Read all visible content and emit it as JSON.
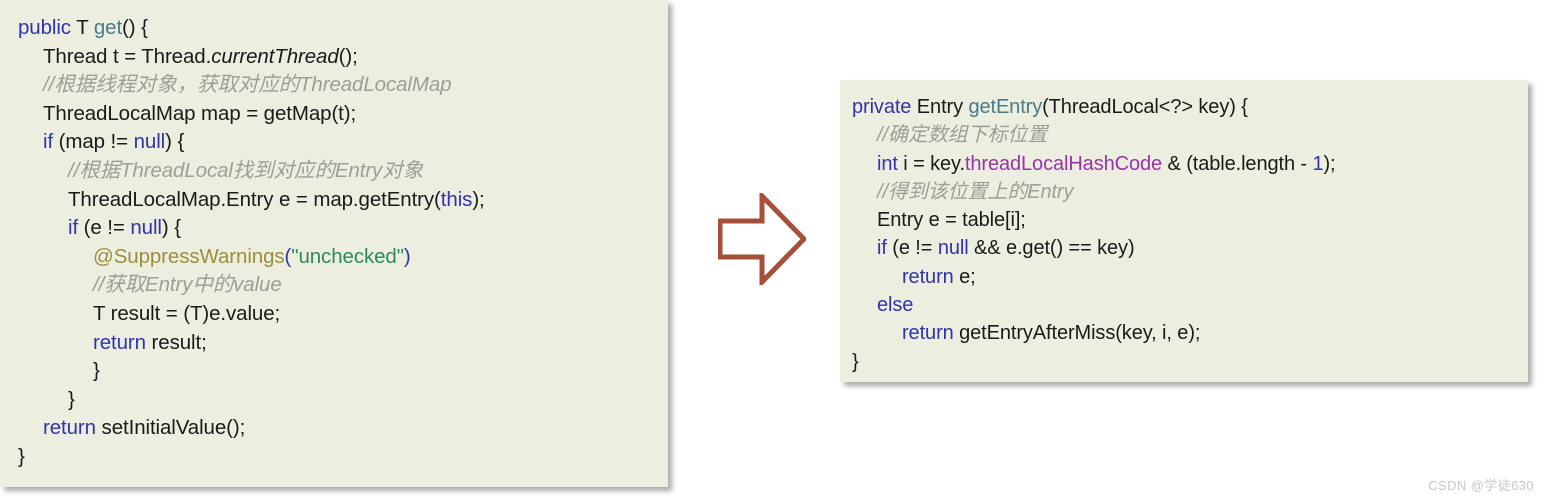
{
  "colors": {
    "panel_background": "#ECEEDF",
    "page_background": "#FFFFFF",
    "keyword": "#3333AA",
    "method": "#4A7A8C",
    "field": "#9933AA",
    "annotation": "#9A8F3C",
    "string": "#2E8B57",
    "comment": "#9E9E96",
    "arrow": "#A6503A"
  },
  "left_panel": {
    "name": "ThreadLocal.get source snippet",
    "lines": [
      {
        "indent": 0,
        "tokens": [
          {
            "text": "public",
            "cls": "t-kw"
          },
          {
            "text": " T ",
            "cls": "t-plain"
          },
          {
            "text": "get",
            "cls": "t-method"
          },
          {
            "text": "() {",
            "cls": "t-plain"
          }
        ]
      },
      {
        "indent": 1,
        "tokens": [
          {
            "text": "Thread t = Thread.",
            "cls": "t-plain"
          },
          {
            "text": "currentThread",
            "cls": "t-plain t-italic"
          },
          {
            "text": "();",
            "cls": "t-plain"
          }
        ]
      },
      {
        "indent": 1,
        "tokens": [
          {
            "text": "//根据线程对象，获取对应的ThreadLocalMap",
            "cls": "t-comment"
          }
        ]
      },
      {
        "indent": 1,
        "tokens": [
          {
            "text": "ThreadLocalMap map = getMap(t);",
            "cls": "t-plain"
          }
        ]
      },
      {
        "indent": 1,
        "tokens": [
          {
            "text": "if",
            "cls": "t-kw"
          },
          {
            "text": " (map != ",
            "cls": "t-plain"
          },
          {
            "text": "null",
            "cls": "t-kw"
          },
          {
            "text": ") {",
            "cls": "t-plain"
          }
        ]
      },
      {
        "indent": 2,
        "tokens": [
          {
            "text": "//根据ThreadLocal找到对应的Entry对象",
            "cls": "t-comment"
          }
        ]
      },
      {
        "indent": 2,
        "tokens": [
          {
            "text": "ThreadLocalMap.Entry e = map.getEntry(",
            "cls": "t-plain"
          },
          {
            "text": "this",
            "cls": "t-kw"
          },
          {
            "text": ");",
            "cls": "t-plain"
          }
        ]
      },
      {
        "indent": 2,
        "tokens": [
          {
            "text": "if",
            "cls": "t-kw"
          },
          {
            "text": " (e != ",
            "cls": "t-plain"
          },
          {
            "text": "null",
            "cls": "t-kw"
          },
          {
            "text": ") {",
            "cls": "t-plain"
          }
        ]
      },
      {
        "indent": 3,
        "tokens": [
          {
            "text": "@SuppressWarnings",
            "cls": "t-anno"
          },
          {
            "text": "(",
            "cls": "t-kw"
          },
          {
            "text": "\"unchecked\"",
            "cls": "t-str"
          },
          {
            "text": ")",
            "cls": "t-kw"
          }
        ]
      },
      {
        "indent": 3,
        "tokens": [
          {
            "text": "//获取Entry中的value",
            "cls": "t-comment"
          }
        ]
      },
      {
        "indent": 3,
        "tokens": [
          {
            "text": "T result = (T)e.value;",
            "cls": "t-plain"
          }
        ]
      },
      {
        "indent": 3,
        "tokens": [
          {
            "text": "return",
            "cls": "t-kw"
          },
          {
            "text": " result;",
            "cls": "t-plain"
          }
        ]
      },
      {
        "indent": 3,
        "tokens": [
          {
            "text": "}",
            "cls": "t-plain"
          }
        ]
      },
      {
        "indent": 2,
        "tokens": [
          {
            "text": "}",
            "cls": "t-plain"
          }
        ]
      },
      {
        "indent": 1,
        "tokens": [
          {
            "text": "return",
            "cls": "t-kw"
          },
          {
            "text": " setInitialValue();",
            "cls": "t-plain"
          }
        ]
      },
      {
        "indent": 0,
        "tokens": [
          {
            "text": "}",
            "cls": "t-plain"
          }
        ]
      }
    ]
  },
  "right_panel": {
    "name": "ThreadLocalMap.getEntry source snippet",
    "lines": [
      {
        "indent": 0,
        "tokens": [
          {
            "text": "private",
            "cls": "t-kw"
          },
          {
            "text": " Entry ",
            "cls": "t-plain"
          },
          {
            "text": "getEntry",
            "cls": "t-method"
          },
          {
            "text": "(ThreadLocal<?> key) {",
            "cls": "t-plain"
          }
        ]
      },
      {
        "indent": 1,
        "tokens": [
          {
            "text": "//确定数组下标位置",
            "cls": "t-comment"
          }
        ]
      },
      {
        "indent": 1,
        "tokens": [
          {
            "text": "int",
            "cls": "t-kw"
          },
          {
            "text": " i = key.",
            "cls": "t-plain"
          },
          {
            "text": "threadLocalHashCode",
            "cls": "t-field"
          },
          {
            "text": " & (table.length - ",
            "cls": "t-plain"
          },
          {
            "text": "1",
            "cls": "t-num"
          },
          {
            "text": ");",
            "cls": "t-plain"
          }
        ]
      },
      {
        "indent": 1,
        "tokens": [
          {
            "text": "//得到该位置上的Entry",
            "cls": "t-comment"
          }
        ]
      },
      {
        "indent": 1,
        "tokens": [
          {
            "text": "Entry e = table[i];",
            "cls": "t-plain"
          }
        ]
      },
      {
        "indent": 1,
        "tokens": [
          {
            "text": "if",
            "cls": "t-kw"
          },
          {
            "text": " (e != ",
            "cls": "t-plain"
          },
          {
            "text": "null",
            "cls": "t-kw"
          },
          {
            "text": " && e.get() == key)",
            "cls": "t-plain"
          }
        ]
      },
      {
        "indent": 2,
        "tokens": [
          {
            "text": "return",
            "cls": "t-kw"
          },
          {
            "text": " e;",
            "cls": "t-plain"
          }
        ]
      },
      {
        "indent": 1,
        "tokens": [
          {
            "text": "else",
            "cls": "t-kw"
          }
        ]
      },
      {
        "indent": 2,
        "tokens": [
          {
            "text": "return",
            "cls": "t-kw"
          },
          {
            "text": " getEntryAfterMiss(key, i, e);",
            "cls": "t-plain"
          }
        ]
      },
      {
        "indent": 0,
        "tokens": [
          {
            "text": "}",
            "cls": "t-plain"
          }
        ]
      }
    ]
  },
  "arrow": {
    "label": "flows-to",
    "direction": "right",
    "color": "#A6503A"
  },
  "watermark": {
    "text": "CSDN @学徒630"
  }
}
